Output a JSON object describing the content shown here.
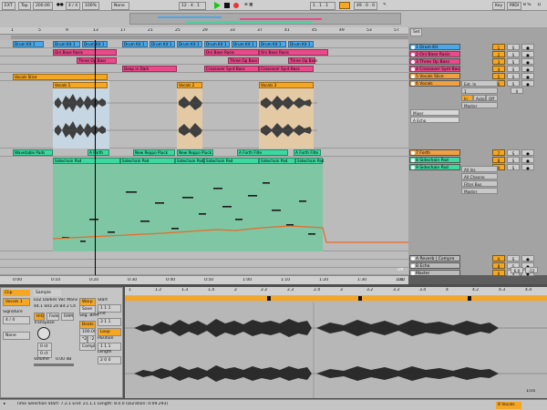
{
  "transport": {
    "ext": "EXT",
    "tap": "Tap",
    "tempo": "200.00",
    "signature": "4 / 4",
    "zoom": "100%",
    "quant": "None",
    "position": "12 . 4 . 1",
    "loop_start": "1 . 1 . 1",
    "loop_len": "49 . 0 . 0",
    "key": "Key",
    "midi": "MIDI",
    "cpu": "8 %",
    "disk": "D"
  },
  "ruler": {
    "bars": [
      "1",
      "5",
      "9",
      "13",
      "17",
      "21",
      "25",
      "29",
      "33",
      "37",
      "41",
      "45",
      "49",
      "53",
      "57",
      "61"
    ],
    "set_label": "Set"
  },
  "timebar": {
    "times": [
      "0:00",
      "0:10",
      "0:20",
      "0:30",
      "0:40",
      "0:50",
      "1:00",
      "1:10",
      "1:20",
      "1:30",
      "1:40"
    ],
    "fraction": "1/1"
  },
  "tracks": [
    {
      "name": "1 Drum Kit",
      "num": "1",
      "color": "#4aa8e8"
    },
    {
      "name": "2 Oni Base Rasis",
      "num": "2",
      "color": "#e84a8a"
    },
    {
      "name": "3 Three Op Bass",
      "num": "3",
      "color": "#e84a8a"
    },
    {
      "name": "4 Crossover Synt Bass",
      "num": "4",
      "color": "#e84a8a"
    },
    {
      "name": "5 Vocals Slice",
      "num": "5",
      "color": "#f0a040"
    },
    {
      "name": "6 Vocals",
      "num": "6",
      "color": "#f0a040"
    },
    {
      "name": "7 Forth",
      "num": "7",
      "color": "#f0a040"
    },
    {
      "name": "8 Sidechain Pad",
      "num": "8",
      "color": "#3cd8a0"
    },
    {
      "name": "9 Sidechain Pad",
      "num": "9",
      "color": "#3cd8a0"
    },
    {
      "name": "A Reverb | Compre",
      "num": "A",
      "color": "#bbbbbb"
    },
    {
      "name": "B Echo",
      "num": "B",
      "color": "#bbbbbb"
    },
    {
      "name": "Master",
      "num": "0",
      "color": "#bbbbbb"
    }
  ],
  "mixer": {
    "ext_in": "Ext. In",
    "in_ch": "1",
    "monitor": [
      "In",
      "Auto",
      "Off"
    ],
    "master": "Master",
    "mixer_label": "Mixer",
    "echo": "A Echo",
    "all_ins": "All Ins",
    "all_channels": "All Channe",
    "filter_bus": "Filter Bus",
    "vol_a": "0",
    "vol_b": "0",
    "vol_c": "-12",
    "vol_d": "6.0"
  },
  "clips": {
    "drum": [
      "Drum Kit 1",
      "Drum Kit 1",
      "Drum Kit 1",
      "Drum Kit 1",
      "Drum Kit 1",
      "Drum Kit 1",
      "Drum Kit 1",
      "Drum Kit 1",
      "Drum Kit 1",
      "Drum Kit 1",
      "Drum Kit 1"
    ],
    "oni": [
      "Oni Base Rasis",
      "Oni Base Rasis",
      "Oni Base Rasis"
    ],
    "three": [
      "Three Op Bass",
      "Three Op Bass",
      "Three Op Bass"
    ],
    "cross": [
      "Deep in Dark",
      "Crossover Synt Bass",
      "Crossover Synt Bass"
    ],
    "vslice": "Vocals Slice",
    "vocal": [
      "Vocals 1",
      "Vocals 2",
      "Vocals 3"
    ],
    "forth": [
      "Wavetable Pads",
      "A Forth",
      "New Reppo Pluck",
      "New Reppo Pluck",
      "A Forth Filte",
      "A Forth Filte"
    ],
    "pad": [
      "Sidechain Pad",
      "Sidechain Pad",
      "Sidechain Pad",
      "Sidechain Pad",
      "Sidechain Pad",
      "Sidechain Pad"
    ]
  },
  "clip_panel": {
    "clip_tab": "Clip",
    "sample_tab": "Sample",
    "clip_name": "Vocals 1",
    "file": "LUZ Dadies Voc Manis",
    "file_info": "44.1 kHz 24 Bit 2 Ch",
    "warp": "Warp",
    "start_label": "Start",
    "start_val": "1 1 1",
    "end_label": "End",
    "end_val": "3 1 1",
    "signature_label": "Signature",
    "sig_val": "4 / 4",
    "groove_label": "Groove",
    "groove_val": "None",
    "hiq": "HiQ",
    "fade": "Fade",
    "ram": "RAM",
    "transpose": "Transpose",
    "transpose_val": "0 st",
    "detune": "0 ct",
    "volume": "Volume",
    "volume_val": "0.00 dB",
    "beats": "Beats",
    "save": "Save",
    "seg_bpm": "Seg. BPM",
    "bpm_val": "100.00",
    "loop": "Loop",
    "position": "Position",
    "length": "Length",
    "pos_val": "1 1 1",
    "len_val": "2 0 0",
    "x2": "*2",
    "half": ":2",
    "warp_val": "Complex"
  },
  "sample_ruler": [
    "1",
    "1.2",
    "1.3",
    "1.4",
    "2",
    "2.2",
    "2.3",
    "2.4",
    "3",
    "3.2",
    "3.3",
    "3.4",
    "4",
    "4.2",
    "4.3",
    "4.4"
  ],
  "status": {
    "text": "Time Selection   Start: 7.2.1   End: 21.1.1   Length: 8.0.0 (Duration: 0:09.293)",
    "fraction": "1/16",
    "track_label": "8 Vocals"
  },
  "colors": {
    "orange": "#f5a623",
    "blue": "#4aa8e8",
    "pink": "#e84a8a",
    "green": "#3cd8a0",
    "play_green": "#19c619"
  }
}
